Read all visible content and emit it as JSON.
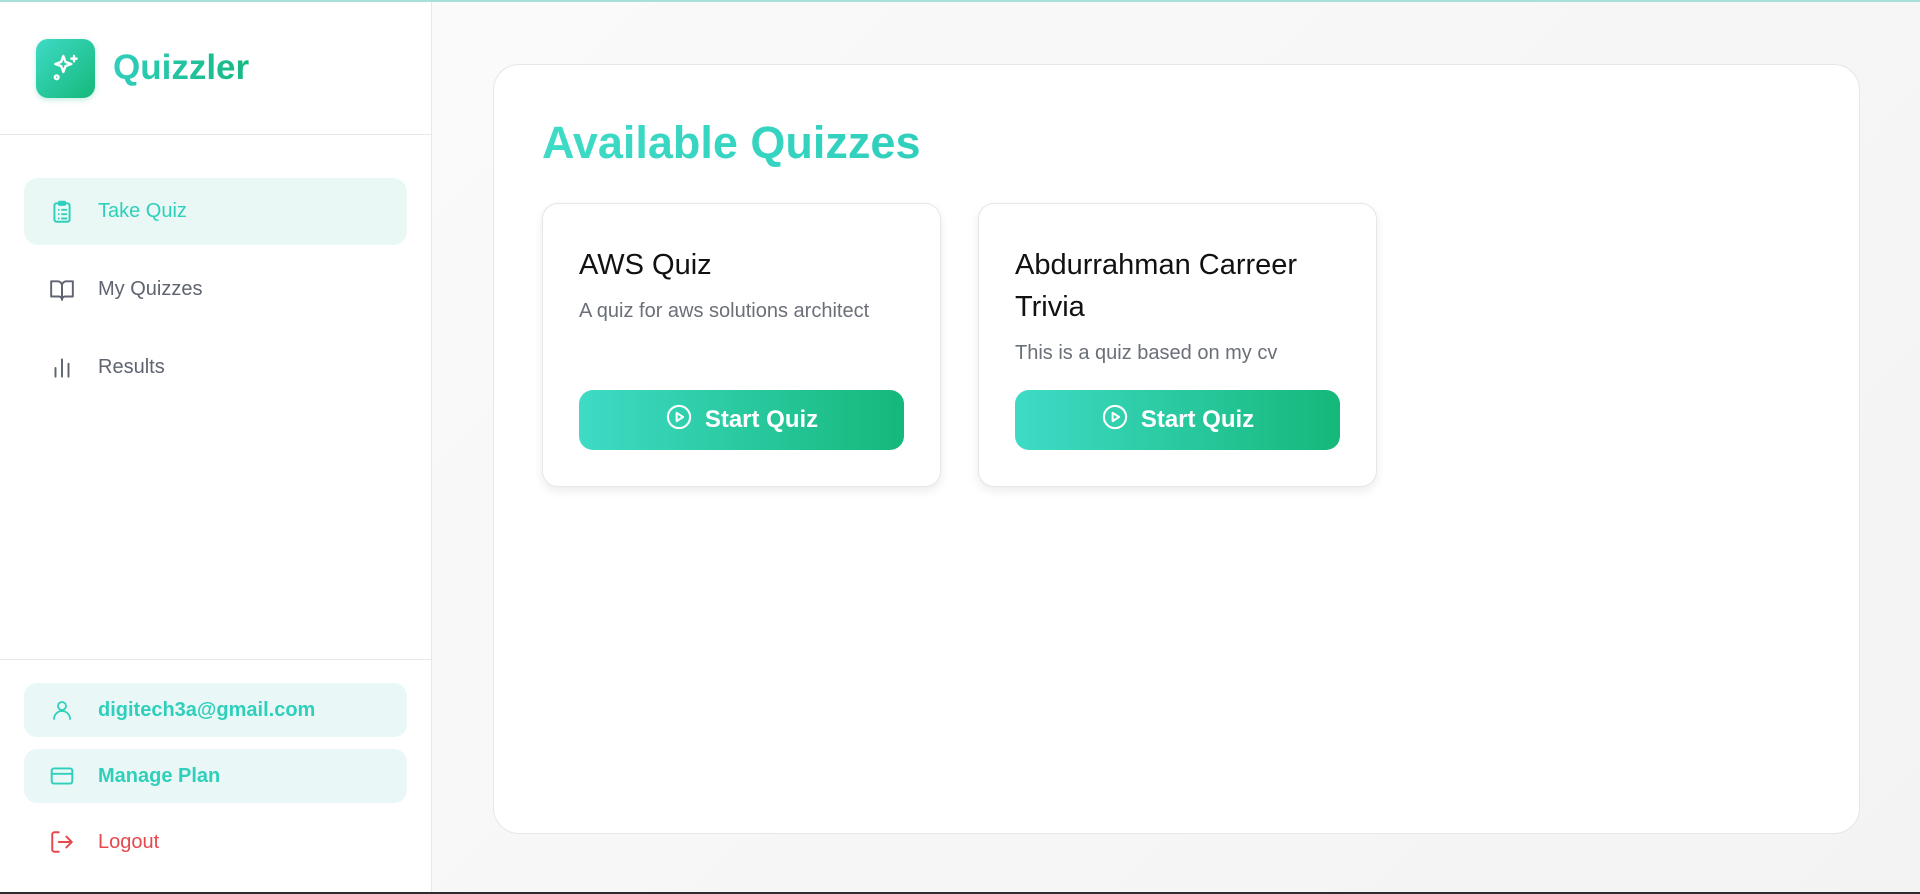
{
  "app": {
    "name": "Quizzler",
    "logo_icon": "sparkles-icon"
  },
  "sidebar": {
    "items": [
      {
        "label": "Take Quiz",
        "icon": "clipboard-list-icon",
        "active": true
      },
      {
        "label": "My Quizzes",
        "icon": "book-open-icon",
        "active": false
      },
      {
        "label": "Results",
        "icon": "bar-chart-icon",
        "active": false
      }
    ],
    "footer": {
      "email": "digitech3a@gmail.com",
      "manage_plan": "Manage Plan",
      "logout": "Logout"
    }
  },
  "main": {
    "title": "Available Quizzes",
    "quizzes": [
      {
        "title": "AWS Quiz",
        "description": "A quiz for aws solutions architect",
        "button": "Start Quiz"
      },
      {
        "title": "Abdurrahman Carreer Trivia",
        "description": "This is a quiz based on my cv",
        "button": "Start Quiz"
      }
    ]
  },
  "colors": {
    "accent": "#2fcfbc",
    "accent_dark": "#15b87a",
    "danger": "#e5484d",
    "active_bg": "#e9f8f4"
  }
}
